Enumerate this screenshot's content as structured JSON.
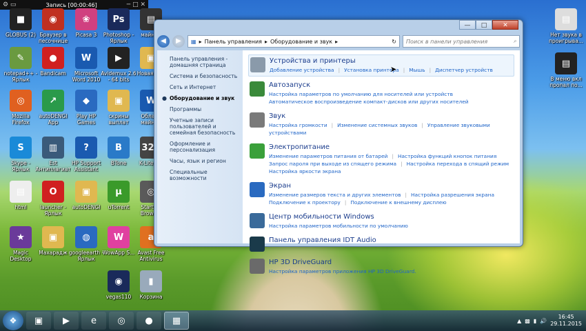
{
  "recorder": {
    "title": "Запись [00:00:46]"
  },
  "desktop": {
    "icons": [
      {
        "label": "GLOBUS (2)",
        "glyph": "■",
        "color": "#222"
      },
      {
        "label": "Браузер в песочнице",
        "glyph": "◉",
        "color": "#c03020"
      },
      {
        "label": "Picasa 3",
        "glyph": "❀",
        "color": "#d04080"
      },
      {
        "label": "Photoshop - Ярлык",
        "glyph": "Ps",
        "color": "#1a2a5a"
      },
      {
        "label": "майнин",
        "glyph": "▤",
        "color": "#333"
      },
      {
        "label": "notepad++ - Ярлык",
        "glyph": "✎",
        "color": "#6a9a40"
      },
      {
        "label": "Bandicam",
        "glyph": "●",
        "color": "#d02020"
      },
      {
        "label": "Microsoft Word 2010",
        "glyph": "W",
        "color": "#1a5ab0"
      },
      {
        "label": "Avidemux 2.6 - 64 bits",
        "glyph": "▶",
        "color": "#222"
      },
      {
        "label": "Новая пап",
        "glyph": "▣",
        "color": "#e0b850"
      },
      {
        "label": "Mozilla Firefox",
        "glyph": "◎",
        "color": "#e06020"
      },
      {
        "label": "autoDENGI App",
        "glyph": "↗",
        "color": "#2a9a4a"
      },
      {
        "label": "Play HP Games",
        "glyph": "◆",
        "color": "#2a6ac0"
      },
      {
        "label": "скрины выплат",
        "glyph": "▣",
        "color": "#e0b850"
      },
      {
        "label": "Облачн майнин",
        "glyph": "W",
        "color": "#1a5ab0"
      },
      {
        "label": "Skype - Ярлык",
        "glyph": "S",
        "color": "#1a8ad8"
      },
      {
        "label": "Est Антиплагиат",
        "glyph": "▥",
        "color": "#3a5a7a"
      },
      {
        "label": "HP Support Assistant",
        "glyph": "?",
        "color": "#1a5ab0"
      },
      {
        "label": "BTone",
        "glyph": "B",
        "color": "#2a7ac8"
      },
      {
        "label": "K-Lite_Co",
        "glyph": "321",
        "color": "#444"
      },
      {
        "label": "html",
        "glyph": "▤",
        "color": "#eee"
      },
      {
        "label": "launcher - Ярлык",
        "glyph": "O",
        "color": "#d02020"
      },
      {
        "label": "autoDENGI",
        "glyph": "▣",
        "color": "#e0b850"
      },
      {
        "label": "uTorrent",
        "glyph": "µ",
        "color": "#3a9a2a"
      },
      {
        "label": "StartTor Browser",
        "glyph": "◎",
        "color": "#5a5a5a"
      },
      {
        "label": "Magic Desktop",
        "glyph": "★",
        "color": "#6a3a9a"
      },
      {
        "label": "Махарадж",
        "glyph": "▣",
        "color": "#e0b850"
      },
      {
        "label": "googleearth - Ярлык",
        "glyph": "◍",
        "color": "#2a6ac0"
      },
      {
        "label": "WowApp S...",
        "glyph": "W",
        "color": "#e040a0"
      },
      {
        "label": "Avast Free Antivirus",
        "glyph": "a",
        "color": "#e07020"
      },
      {
        "label": "vegas110",
        "glyph": "◉",
        "color": "#1a2a5a"
      },
      {
        "label": "Корзина",
        "glyph": "▮",
        "color": "#9ab"
      },
      {
        "label": "Нет звука в проигрыва...",
        "glyph": "▤",
        "color": "#ddd"
      },
      {
        "label": "В меню вкл пропал по...",
        "glyph": "▤",
        "color": "#222"
      }
    ]
  },
  "window": {
    "controls": {
      "min": "—",
      "max": "□",
      "close": "✕"
    },
    "address": {
      "crumbs": [
        "Панель управления",
        "Оборудование и звук"
      ],
      "sep": "▸"
    },
    "search": {
      "placeholder": "Поиск в панели управления",
      "icon": "⌕"
    },
    "leftnav": {
      "items": [
        "Панель управления - домашняя страница",
        "Система и безопасность",
        "Сеть и Интернет",
        "Оборудование и звук",
        "Программы",
        "Учетные записи пользователей и семейная безопасность",
        "Оформление и персонализация",
        "Часы, язык и регион",
        "Специальные возможности"
      ],
      "active_index": 3
    },
    "categories": [
      {
        "title": "Устройства и принтеры",
        "color": "#8a9aaa",
        "links": [
          [
            "Добавление устройства",
            "Установка принтера",
            "Мышь",
            "Диспетчер устройств"
          ]
        ]
      },
      {
        "title": "Автозапуск",
        "color": "#3a8a3a",
        "links": [
          [
            "Настройка параметров по умолчанию для носителей или устройств"
          ],
          [
            "Автоматическое воспроизведение компакт-дисков или других носителей"
          ]
        ]
      },
      {
        "title": "Звук",
        "color": "#7a7a7a",
        "links": [
          [
            "Настройка громкости",
            "Изменение системных звуков",
            "Управление звуковыми устройствами"
          ]
        ]
      },
      {
        "title": "Электропитание",
        "color": "#3aa03a",
        "links": [
          [
            "Изменение параметров питания от батарей",
            "Настройка функций кнопок питания"
          ],
          [
            "Запрос пароля при выходе из спящего режима",
            "Настройка перехода в спящий режим"
          ],
          [
            "Настройка яркости экрана"
          ]
        ]
      },
      {
        "title": "Экран",
        "color": "#2a6ac0",
        "links": [
          [
            "Изменение размеров текста и других элементов",
            "Настройка разрешения экрана"
          ],
          [
            "Подключение к проектору",
            "Подключение к внешнему дисплею"
          ]
        ]
      },
      {
        "title": "Центр мобильности Windows",
        "color": "#3a6a9a",
        "links": [
          [
            "Настройка параметров мобильности по умолчанию"
          ]
        ]
      },
      {
        "title": "Панель управления IDT Audio",
        "color": "#1a3a4a",
        "links": []
      },
      {
        "title": "HP 3D DriveGuard",
        "color": "#6a6a6a",
        "links": [
          [
            "Настройка параметров приложения HP 3D DriveGuard."
          ]
        ]
      }
    ]
  },
  "taskbar": {
    "items": [
      {
        "name": "explorer",
        "glyph": "▣"
      },
      {
        "name": "media-player",
        "glyph": "▶"
      },
      {
        "name": "internet-explorer",
        "glyph": "e"
      },
      {
        "name": "chrome",
        "glyph": "◎"
      },
      {
        "name": "bandicam",
        "glyph": "●"
      },
      {
        "name": "control-panel",
        "glyph": "▦"
      }
    ],
    "time": "16:45",
    "date": "29.11.2015"
  }
}
